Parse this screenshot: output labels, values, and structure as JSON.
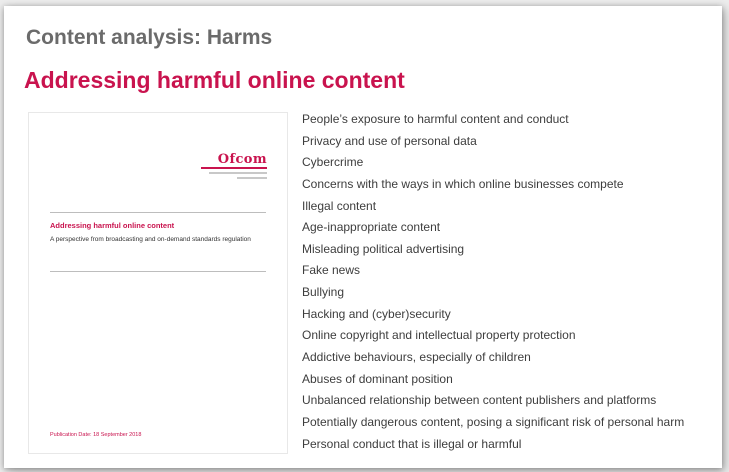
{
  "slide": {
    "section_title": "Content analysis: Harms",
    "main_title": "Addressing harmful online content"
  },
  "document_thumbnail": {
    "logo_text": "Ofcom",
    "title": "Addressing harmful online content",
    "subtitle": "A perspective from broadcasting and on-demand standards regulation",
    "publication_date": "Publication Date: 18 September 2018"
  },
  "harms": [
    "People’s exposure to harmful content and conduct",
    "Privacy and use of personal data",
    "Cybercrime",
    "Concerns with the ways in which online businesses compete",
    "Illegal content",
    "Age-inappropriate content",
    "Misleading political advertising",
    "Fake news",
    "Bullying",
    "Hacking and (cyber)security",
    "Online copyright and intellectual property protection",
    "Addictive behaviours, especially of children",
    "Abuses of dominant position",
    "Unbalanced relationship between content publishers and platforms",
    "Potentially dangerous content, posing a significant risk of personal harm",
    "Personal conduct that is illegal or harmful"
  ],
  "colors": {
    "accent": "#c9134e",
    "section_title": "#6b6b6b",
    "body_text": "#3d3d3d"
  }
}
